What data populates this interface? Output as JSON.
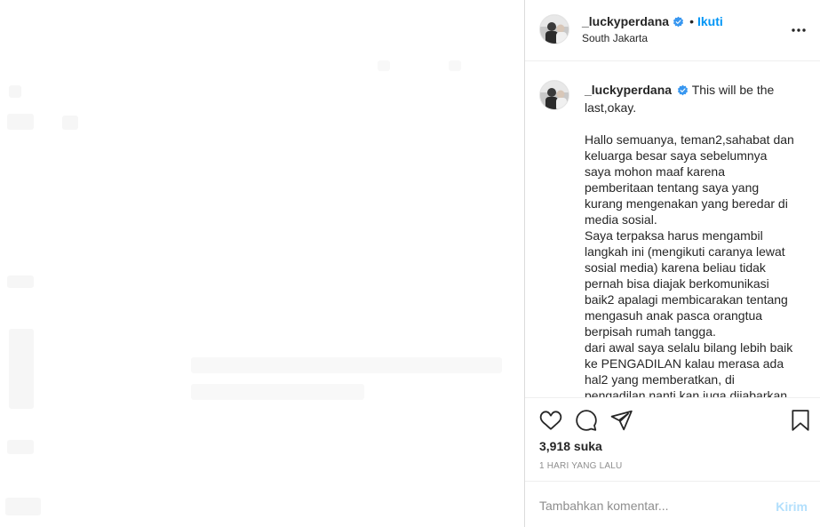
{
  "post": {
    "username": "_luckyperdana",
    "follow_label": "Ikuti",
    "separator": "•",
    "location": "South Jakarta"
  },
  "caption": {
    "username": "_luckyperdana",
    "title": "This will be the last,okay.",
    "body": "Hallo semuanya, teman2,sahabat dan keluarga besar saya sebelumnya saya mohon maaf karena pemberitaan tentang saya yang kurang mengenakan yang beredar di media sosial.\nSaya terpaksa harus mengambil langkah ini (mengikuti caranya lewat sosial media) karena beliau tidak pernah bisa diajak berkomunikasi baik2 apalagi membicarakan tentang mengasuh anak pasca orangtua berpisah rumah tangga.\ndari awal saya selalu bilang lebih baik ke PENGADILAN kalau merasa ada hal2 yang memberatkan,  di pengadilan nanti kan juga dijabarkan"
  },
  "stats": {
    "likes": "3,918 suka",
    "time_ago": "1 HARI YANG LALU"
  },
  "comment_input": {
    "placeholder": "Tambahkan komentar...",
    "post_label": "Kirim"
  },
  "colors": {
    "accent": "#0095f6",
    "verified": "#3897f0",
    "post_disabled": "#b2dffc",
    "border": "#dbdbdb"
  },
  "icons": [
    "verified-badge-icon",
    "more-options-icon",
    "heart-icon",
    "comment-bubble-icon",
    "share-icon",
    "bookmark-icon"
  ]
}
